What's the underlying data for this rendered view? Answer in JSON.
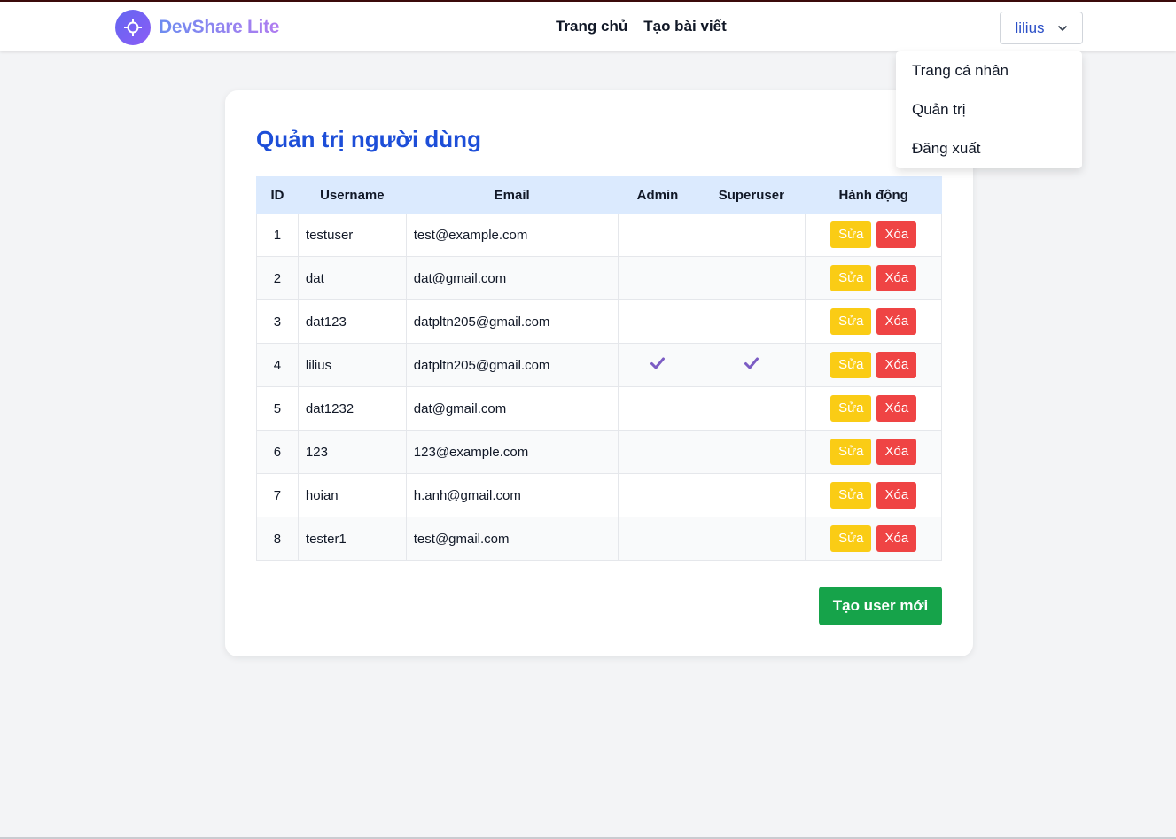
{
  "brand": {
    "name": "DevShare Lite",
    "logo_icon": "crosshair-icon"
  },
  "nav": {
    "links": [
      "Trang chủ",
      "Tạo bài viết"
    ]
  },
  "user_menu": {
    "username": "lilius",
    "chevron_icon": "chevron-down-icon",
    "items": [
      "Trang cá nhân",
      "Quản trị",
      "Đăng xuất"
    ]
  },
  "page": {
    "title": "Quản trị người dùng",
    "columns": [
      "ID",
      "Username",
      "Email",
      "Admin",
      "Superuser",
      "Hành động"
    ],
    "users": [
      {
        "id": "1",
        "username": "testuser",
        "email": "test@example.com",
        "admin": false,
        "superuser": false
      },
      {
        "id": "2",
        "username": "dat",
        "email": "dat@gmail.com",
        "admin": false,
        "superuser": false
      },
      {
        "id": "3",
        "username": "dat123",
        "email": "datpltn205@gmail.com",
        "admin": false,
        "superuser": false
      },
      {
        "id": "4",
        "username": "lilius",
        "email": "datpltn205@gmail.com",
        "admin": true,
        "superuser": true
      },
      {
        "id": "5",
        "username": "dat1232",
        "email": "dat@gmail.com",
        "admin": false,
        "superuser": false
      },
      {
        "id": "6",
        "username": "123",
        "email": "123@example.com",
        "admin": false,
        "superuser": false
      },
      {
        "id": "7",
        "username": "hoian",
        "email": "h.anh@gmail.com",
        "admin": false,
        "superuser": false
      },
      {
        "id": "8",
        "username": "tester1",
        "email": "test@gmail.com",
        "admin": false,
        "superuser": false
      }
    ],
    "edit_label": "Sửa",
    "delete_label": "Xóa",
    "create_label": "Tạo user mới"
  },
  "colors": {
    "accent": "#1d4ed8",
    "edit": "#facc15",
    "delete": "#ef4444",
    "create": "#16a34a",
    "check": "#7c5cc4"
  }
}
